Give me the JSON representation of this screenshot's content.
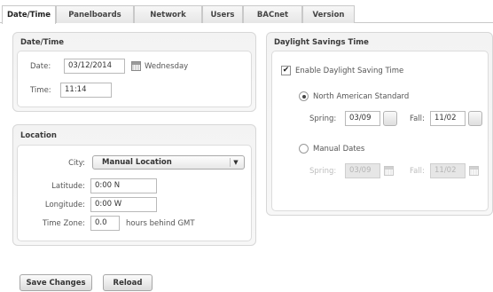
{
  "tabs": [
    {
      "label": "Date/Time",
      "active": true
    },
    {
      "label": "Panelboards",
      "active": false
    },
    {
      "label": "Network",
      "active": false
    },
    {
      "label": "Users",
      "active": false
    },
    {
      "label": "BACnet",
      "active": false
    },
    {
      "label": "Version",
      "active": false
    }
  ],
  "datetime": {
    "title": "Date/Time",
    "date_label": "Date:",
    "date_value": "03/12/2014",
    "weekday": "Wednesday",
    "time_label": "Time:",
    "time_value": "11:14"
  },
  "location": {
    "title": "Location",
    "city_label": "City:",
    "city_value": "Manual Location",
    "latitude_label": "Latitude:",
    "latitude_value": "0:00 N",
    "longitude_label": "Longitude:",
    "longitude_value": "0:00 W",
    "timezone_label": "Time Zone:",
    "timezone_value": "0.0",
    "timezone_suffix": "hours behind GMT"
  },
  "dst": {
    "title": "Daylight Savings Time",
    "enable_label": "Enable Daylight Saving Time",
    "enable_checked": true,
    "north_american_label": "North American Standard",
    "north_american_selected": true,
    "spring_label": "Spring:",
    "spring_value": "03/09",
    "fall_label": "Fall:",
    "fall_value": "11/02",
    "manual_label": "Manual Dates",
    "manual_selected": false,
    "manual_spring_label": "Spring:",
    "manual_spring_value": "03/09",
    "manual_fall_label": "Fall:",
    "manual_fall_value": "11/02"
  },
  "actions": {
    "save_label": "Save Changes",
    "reload_label": "Reload"
  },
  "icons": {
    "check": "✔",
    "dropdown": "▼"
  }
}
